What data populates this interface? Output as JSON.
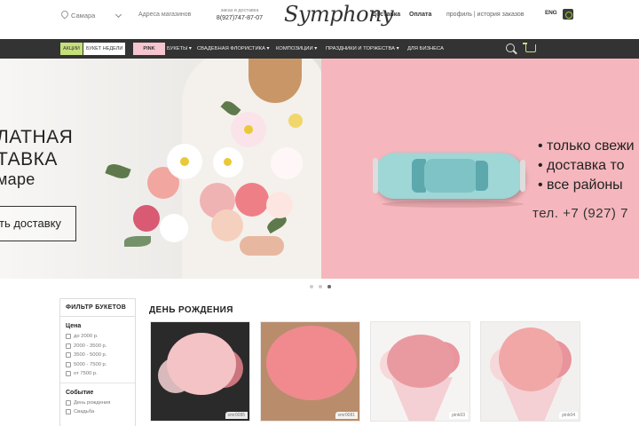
{
  "header": {
    "city": "Самара",
    "stores_link": "Адреса магазинов",
    "phone_note": "заказ и доставка",
    "phone": "8(927)747-87-07",
    "logo": "Symphony",
    "delivery": "Доставка",
    "payment": "Оплата",
    "profile": "профиль | история заказов",
    "lang": "ENG"
  },
  "nav": {
    "sale": "АКЦИИ",
    "week": "БУКЕТ НЕДЕЛИ",
    "pink": "PINK",
    "items": [
      "БУКЕТЫ ▾",
      "СВАДЕБНАЯ ФЛОРИСТИКА ▾",
      "КОМПОЗИЦИИ ▾",
      "ПРАЗДНИКИ И ТОРЖЕСТВА ▾",
      "ДЛЯ БИЗНЕСА"
    ]
  },
  "hero": {
    "title_line1": "ЛАТНАЯ",
    "title_line2": "ТАВКА",
    "subtitle": "маре",
    "button": "ть доставку",
    "bullets": [
      "только свежи",
      "доставка то",
      "все районы"
    ],
    "phone": "тел. +7 (927) 7"
  },
  "slider": {
    "count": 3,
    "active": 3
  },
  "filter": {
    "title": "ФИЛЬТР БУКЕТОВ",
    "price_label": "Цена",
    "prices": [
      "до 2000 р.",
      "2000 - 3500 р.",
      "3500 - 5000 р.",
      "5000 - 7500 р.",
      "от 7500 р."
    ],
    "event_label": "Событие",
    "events": [
      "День рождения",
      "Свадьба"
    ]
  },
  "section": {
    "title": "ДЕНЬ РОЖДЕНИЯ"
  },
  "products": [
    {
      "sku": "smr0085",
      "bg": "#2a2a2a",
      "main": "#f4c3c6"
    },
    {
      "sku": "smr0081",
      "bg": "#b98d6c",
      "main": "#f08a8f"
    },
    {
      "sku": "pink03",
      "bg": "#f6f4f2",
      "main": "#e99aa1"
    },
    {
      "sku": "pink04",
      "bg": "#f2f0ee",
      "main": "#f0a7a6"
    }
  ],
  "colors": {
    "accent_green": "#c5df7b",
    "pink_bg": "#f5b7bd",
    "nav_bg": "#333333",
    "car": "#9fd6d6"
  }
}
